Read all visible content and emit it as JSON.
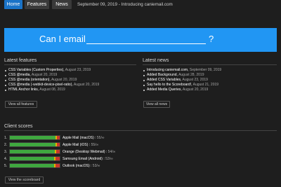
{
  "nav": {
    "home_label": "Home",
    "features_label": "Features",
    "news_label": "News",
    "latest_news_link": "September 09, 2019 - Introducing caniemail.com"
  },
  "hero": {
    "prefix": "Can I email",
    "input_value": "",
    "input_placeholder": "",
    "suffix": "?",
    "background_color": "#2196f3"
  },
  "latest_features": {
    "title": "Latest features",
    "items": [
      {
        "title": "CSS Variables (Custom Properties)",
        "date": "August 23, 2019"
      },
      {
        "title": "CSS @media",
        "date": "August 20, 2019"
      },
      {
        "title": "CSS @media (orientation)",
        "date": "August 20, 2019"
      },
      {
        "title": "CSS @media (-webkit-device-pixel-ratio)",
        "date": "August 20, 2019"
      },
      {
        "title": "HTML Anchor links",
        "date": "August 08, 2019"
      }
    ],
    "button_label": "View all features"
  },
  "latest_news": {
    "title": "Latest news",
    "items": [
      {
        "title": "Introducing caniemail.com",
        "date": "September 09, 2019"
      },
      {
        "title": "Added Background",
        "date": "August 28, 2019"
      },
      {
        "title": "Added CSS Variables",
        "date": "August 23, 2019"
      },
      {
        "title": "Say hello to the Scoreboard!",
        "date": "August 21, 2019"
      },
      {
        "title": "Added Media Queries",
        "date": "August 20, 2019"
      }
    ],
    "button_label": "View all news"
  },
  "client_scores": {
    "title": "Client scores",
    "items": [
      {
        "rank": "1.",
        "client": "Apple Mail (macOS)",
        "score": "55",
        "supported": 0.92,
        "partial": 0.02,
        "unsupported": 0.06
      },
      {
        "rank": "2.",
        "client": "Apple Mail (iOS)",
        "score": "55",
        "supported": 0.92,
        "partial": 0.02,
        "unsupported": 0.06
      },
      {
        "rank": "3.",
        "client": "Orange (Desktop Webmail)",
        "score": "54",
        "supported": 0.9,
        "partial": 0.03,
        "unsupported": 0.07
      },
      {
        "rank": "4.",
        "client": "Samsung Email (Android)",
        "score": "53",
        "supported": 0.89,
        "partial": 0.03,
        "unsupported": 0.08
      },
      {
        "rank": "5.",
        "client": "Outlook (macOS)",
        "score": "53",
        "supported": 0.89,
        "partial": 0.02,
        "unsupported": 0.09
      }
    ],
    "score_unit": "/∞",
    "button_label": "View the scoreboard"
  }
}
